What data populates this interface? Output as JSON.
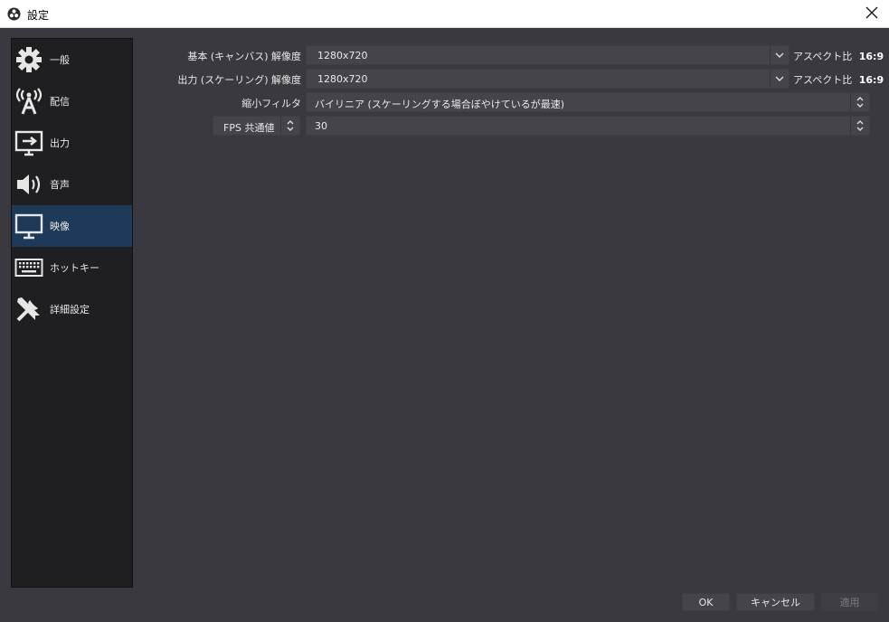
{
  "window": {
    "title": "設定",
    "close_symbol": "✕"
  },
  "sidebar": {
    "items": [
      {
        "label": "一般",
        "icon": "gear-icon"
      },
      {
        "label": "配信",
        "icon": "broadcast-tower-icon"
      },
      {
        "label": "出力",
        "icon": "output-monitor-icon"
      },
      {
        "label": "音声",
        "icon": "speaker-icon"
      },
      {
        "label": "映像",
        "icon": "monitor-icon",
        "selected": true
      },
      {
        "label": "ホットキー",
        "icon": "keyboard-icon"
      },
      {
        "label": "詳細設定",
        "icon": "tools-icon"
      }
    ]
  },
  "video": {
    "base_resolution": {
      "label": "基本 (キャンバス) 解像度",
      "value": "1280x720",
      "aspect_label": "アスペクト比",
      "aspect_value": "16:9"
    },
    "output_resolution": {
      "label": "出力 (スケーリング) 解像度",
      "value": "1280x720",
      "aspect_label": "アスペクト比",
      "aspect_value": "16:9"
    },
    "downscale_filter": {
      "label": "縮小フィルタ",
      "value": "バイリニア (スケーリングする場合ぼやけているが最速)"
    },
    "fps": {
      "type_value": "FPS 共通値",
      "value": "30"
    }
  },
  "buttons": {
    "ok": "OK",
    "cancel": "キャンセル",
    "apply": "適用"
  },
  "colors": {
    "background": "#3a393f",
    "sidebar": "#1f1e21",
    "selected": "#1e3a59",
    "input": "#45444b"
  }
}
